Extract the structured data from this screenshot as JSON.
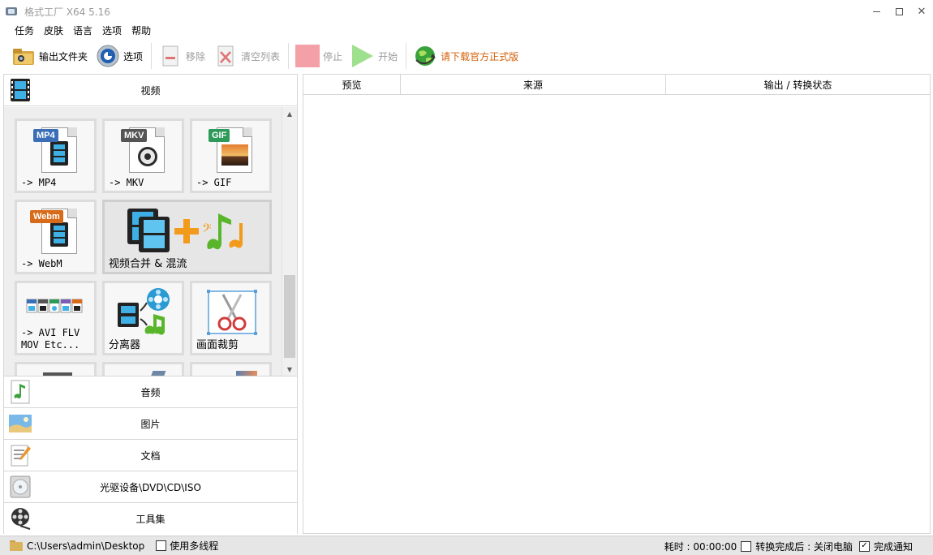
{
  "window": {
    "title": "格式工厂 X64 5.16",
    "min_icon": "minimize-icon",
    "max_icon": "maximize-icon",
    "close_icon": "close-icon",
    "close_glyph": "✕"
  },
  "menu": [
    "任务",
    "皮肤",
    "语言",
    "选项",
    "帮助"
  ],
  "toolbar": {
    "output_folder": "输出文件夹",
    "options": "选项",
    "remove": "移除",
    "clear_list": "清空列表",
    "stop": "停止",
    "start": "开始",
    "download_official": "请下载官方正式版"
  },
  "left": {
    "video_category": "视频",
    "tiles": [
      {
        "badge": "MP4",
        "badge_color": "#3a6fb8",
        "label": "-> MP4"
      },
      {
        "badge": "MKV",
        "badge_color": "#555555",
        "label": "-> MKV"
      },
      {
        "badge": "GIF",
        "badge_color": "#2e9a59",
        "label": "-> GIF"
      },
      {
        "badge": "Webm",
        "badge_color": "#d76b1a",
        "label": "-> WebM"
      },
      {
        "label": "视频合并 & 混流"
      },
      {
        "label": "-> AVI FLV\nMOV Etc..."
      },
      {
        "label": "分离器"
      },
      {
        "label": "画面裁剪"
      }
    ],
    "scroll_up_glyph": "▲",
    "scroll_down_glyph": "▼",
    "categories": [
      "音频",
      "图片",
      "文档",
      "光驱设备\\DVD\\CD\\ISO",
      "工具集"
    ]
  },
  "right": {
    "columns": [
      "预览",
      "来源",
      "输出 / 转换状态"
    ]
  },
  "status": {
    "path": "C:\\Users\\admin\\Desktop",
    "multithread_label": "使用多线程",
    "elapsed_label": "耗时 : 00:00:00",
    "after_convert_label": "转换完成后 : 关闭电脑",
    "notify_label": "完成通知",
    "check_glyph": "✓"
  }
}
